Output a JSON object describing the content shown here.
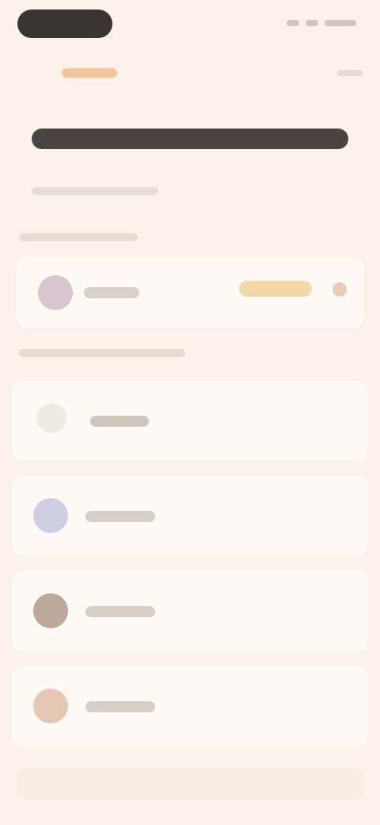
{
  "status_bar": {
    "time": "",
    "icons": [
      "signal-icon",
      "wifi-icon",
      "battery-icon"
    ]
  },
  "nav": {
    "back_label": "",
    "menu_label": ""
  },
  "header": {
    "title": "",
    "subtitle": ""
  },
  "sections": {
    "current": {
      "label": ""
    },
    "list": {
      "label": ""
    }
  },
  "current_item": {
    "name": "",
    "badge": ""
  },
  "list_items": [
    {
      "name": ""
    },
    {
      "name": ""
    },
    {
      "name": ""
    },
    {
      "name": ""
    }
  ],
  "colors": {
    "background": "#fbf3ea",
    "card": "#fffaf5",
    "accent": "#f2c89a",
    "badge": "#f3d9a6",
    "avatar_1": "#d8c6cf",
    "avatar_2": "#cfcfe3",
    "avatar_3": "#bda89c",
    "avatar_4": "#e5c9b5"
  }
}
